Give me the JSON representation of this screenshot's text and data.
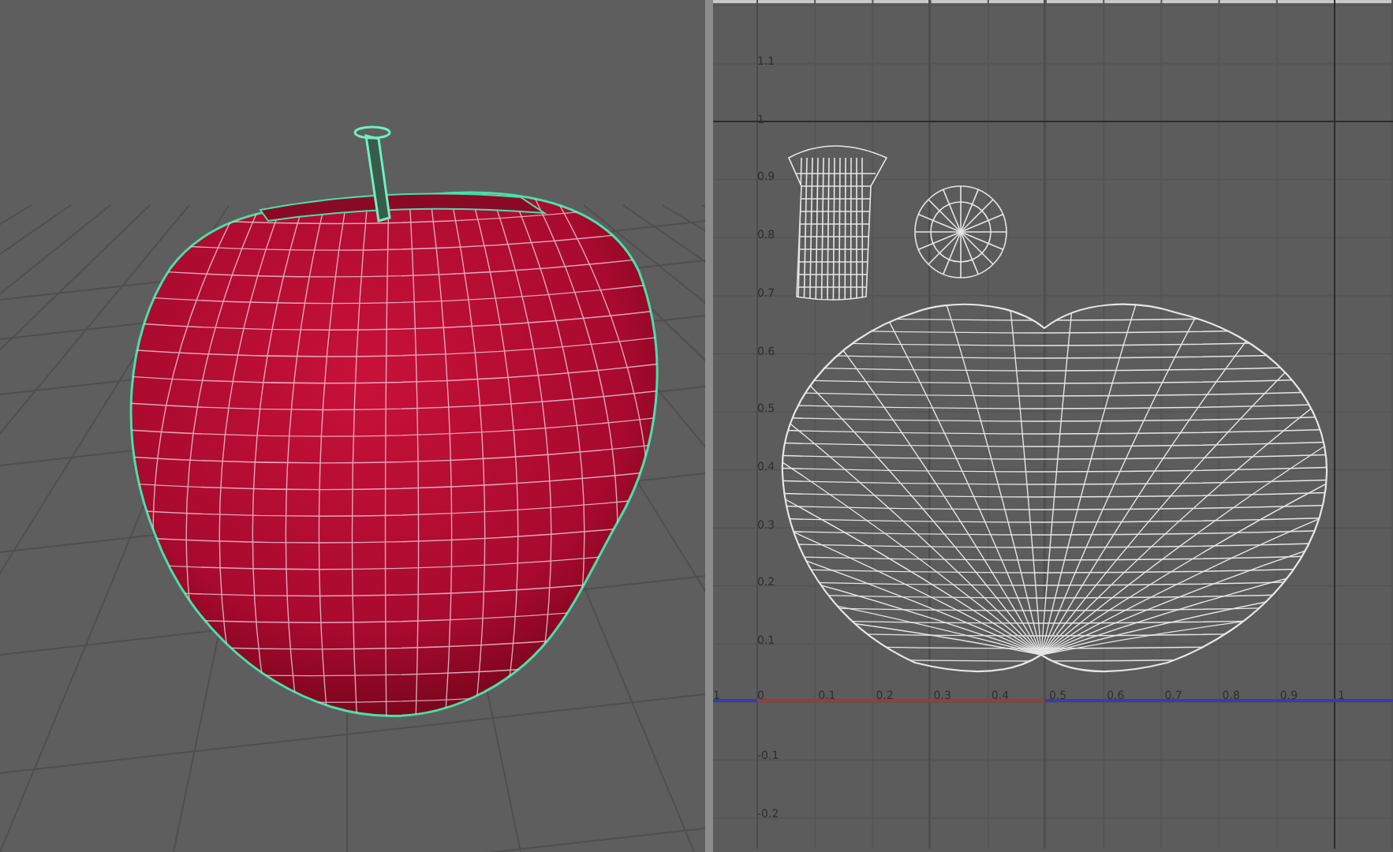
{
  "uv_editor": {
    "v_labels": [
      "1.1",
      "1",
      "0.9",
      "0.8",
      "0.7",
      "0.6",
      "0.5",
      "0.4",
      "0.3",
      "0.2",
      "0.1",
      "-0.1",
      "-0.2"
    ],
    "u_labels": [
      "1",
      "0",
      "0.1",
      "0.2",
      "0.3",
      "0.4",
      "0.5",
      "0.6",
      "0.7",
      "0.8",
      "0.9",
      "1"
    ]
  }
}
